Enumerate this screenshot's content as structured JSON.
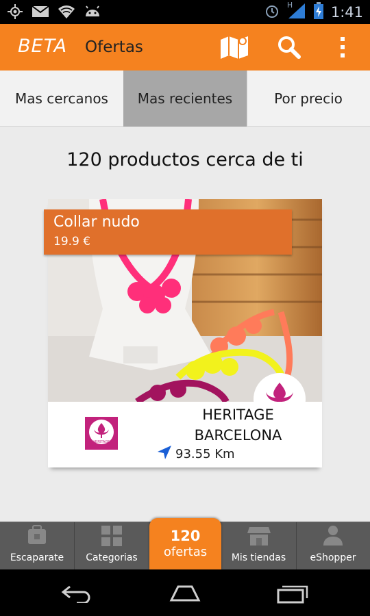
{
  "status_bar": {
    "time": "1:41",
    "network_label": "H",
    "icons": [
      "gps-icon",
      "mail-icon",
      "wifi-icon",
      "android-icon",
      "alarm-icon",
      "signal-icon",
      "battery-charging-icon"
    ]
  },
  "action_bar": {
    "beta_label": "BETA",
    "title": "Ofertas",
    "icons": [
      "map-icon",
      "search-icon",
      "overflow-menu-icon"
    ]
  },
  "tabs": [
    {
      "label": "Mas cercanos",
      "active": false
    },
    {
      "label": "Mas recientes",
      "active": true
    },
    {
      "label": "Por precio",
      "active": false
    }
  ],
  "heading": "120 productos cerca de ti",
  "product": {
    "name": "Collar nudo",
    "price": "19.9 €",
    "store_line1": "HERITAGE",
    "store_line2": "BARCELONA",
    "distance": "93.55 Km",
    "logo_text": "HERITAGE"
  },
  "bottom_nav": {
    "items": [
      {
        "label": "Escaparate",
        "icon": "storefront-icon"
      },
      {
        "label": "Categorias",
        "icon": "grid-icon"
      },
      {
        "label": "Mis tiendas",
        "icon": "shop-icon"
      },
      {
        "label": "eShopper",
        "icon": "user-icon"
      }
    ],
    "offers_count": "120",
    "offers_label": "ofertas"
  },
  "colors": {
    "accent": "#f5821f",
    "price_tag": "#e0702b",
    "brand_magenta": "#c2227c",
    "tab_active": "#a7a7a7",
    "bottom_nav": "#5a5a5a"
  }
}
